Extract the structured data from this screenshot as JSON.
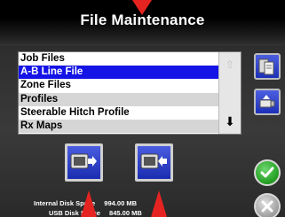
{
  "header": {
    "title": "File Maintenance"
  },
  "file_list": {
    "items": [
      {
        "label": "Job Files",
        "state": "normal"
      },
      {
        "label": "A-B Line File",
        "state": "selected"
      },
      {
        "label": "Zone Files",
        "state": "normal"
      },
      {
        "label": "Profiles",
        "state": "alt"
      },
      {
        "label": "Steerable Hitch Profile",
        "state": "normal"
      },
      {
        "label": "Rx Maps",
        "state": "alt"
      }
    ]
  },
  "storage": {
    "internal_label": "Internal Disk Space",
    "internal_value": "994.00 MB",
    "usb_label": "USB Disk Space",
    "usb_value": "845.00 MB"
  },
  "colors": {
    "selected": "#1414e6",
    "button_blue": "#1c2fb8",
    "ok_green": "#2aa52a",
    "callout_red": "#e52421"
  },
  "icons": {
    "export": "export-to-usb-icon",
    "import": "import-from-usb-icon",
    "ok": "checkmark-icon",
    "cancel": "x-icon"
  }
}
